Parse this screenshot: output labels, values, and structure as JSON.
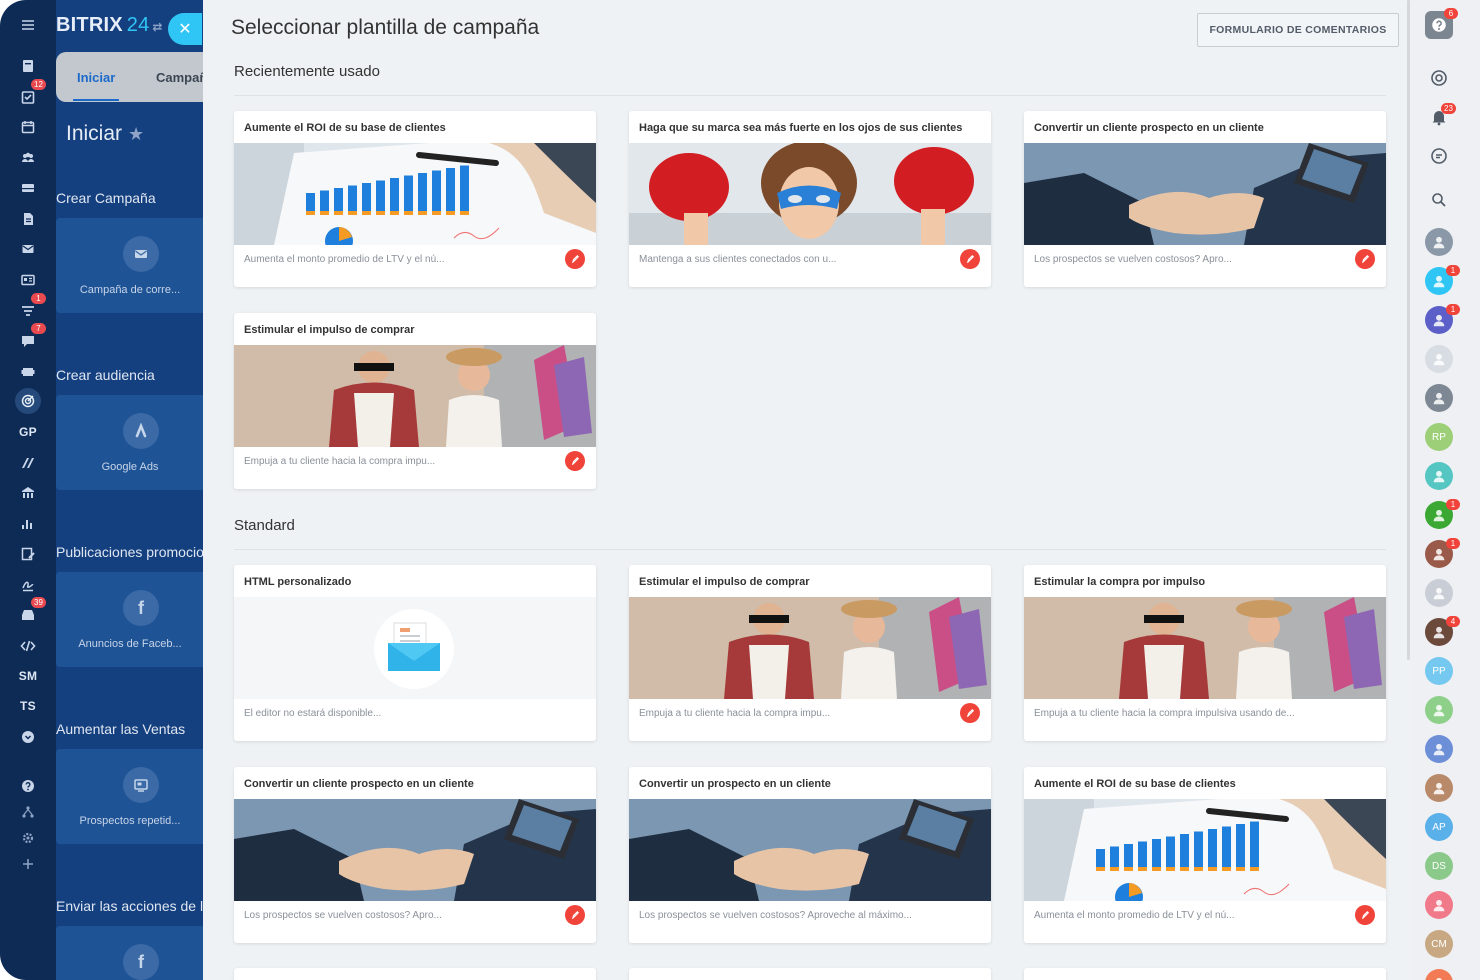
{
  "brand": {
    "name": "BITRIX",
    "version": "24"
  },
  "left_rail": {
    "items": [
      {
        "name": "menu-icon"
      },
      {
        "name": "feed-icon"
      },
      {
        "name": "tasks-icon",
        "badge": "12"
      },
      {
        "name": "calendar-icon"
      },
      {
        "name": "contacts-icon"
      },
      {
        "name": "drive-icon"
      },
      {
        "name": "documents-icon"
      },
      {
        "name": "mail-icon"
      },
      {
        "name": "crm-icon"
      },
      {
        "name": "funnel-icon",
        "badge": "1"
      },
      {
        "name": "chat-icon",
        "badge": "7"
      },
      {
        "name": "store-icon"
      },
      {
        "name": "marketing-icon"
      }
    ],
    "labels": {
      "gp": "GP",
      "sm": "SM",
      "ts": "TS"
    },
    "lower_badge": "39"
  },
  "left_panel": {
    "tabs": [
      "Iniciar",
      "Campañas"
    ],
    "title": "Iniciar",
    "sections": [
      {
        "title": "Crear Campaña",
        "tile": "Campaña de corre...",
        "icon": "mail-icon"
      },
      {
        "title": "Crear audiencia",
        "tile": "Google Ads",
        "icon": "google-ads-icon"
      },
      {
        "title": "Publicaciones promocionadas",
        "tile": "Anuncios de Faceb...",
        "icon": "facebook-icon"
      },
      {
        "title": "Aumentar las Ventas",
        "tile": "Prospectos repetid...",
        "icon": "leads-icon"
      },
      {
        "title": "Enviar las acciones de la empresa",
        "tile": "",
        "icon": "facebook-icon"
      }
    ]
  },
  "main": {
    "title": "Seleccionar plantilla de campaña",
    "feedback_button": "FORMULARIO DE COMENTARIOS",
    "recent_title": "Recientemente usado",
    "standard_title": "Standard",
    "recent_cards": [
      {
        "title": "Aumente el ROI de su base de clientes",
        "desc": "Aumenta el monto promedio de LTV y el nú...",
        "image": "chart",
        "badge": true
      },
      {
        "title": "Haga que su marca sea más fuerte en los ojos de sus clientes",
        "desc": "Mantenga a sus clientes conectados con u...",
        "image": "kid",
        "badge": true
      },
      {
        "title": "Convertir un cliente prospecto en un cliente",
        "desc": "Los prospectos se vuelven costosos? Apro...",
        "image": "handshake",
        "badge": true
      },
      {
        "title": "Estimular el impulso de comprar",
        "desc": "Empuja a tu cliente hacia la compra impu...",
        "image": "shopping",
        "badge": true
      }
    ],
    "standard_cards": [
      {
        "title": "HTML personalizado",
        "desc": "El editor no estará disponible...",
        "image": "html",
        "badge": false
      },
      {
        "title": "Estimular el impulso de comprar",
        "desc": "Empuja a tu cliente hacia la compra impu...",
        "image": "shopping",
        "badge": true
      },
      {
        "title": "Estimular la compra por impulso",
        "desc": "Empuja a tu cliente hacia la compra impulsiva usando de...",
        "image": "shopping",
        "badge": false
      },
      {
        "title": "Convertir un cliente prospecto en un cliente",
        "desc": "Los prospectos se vuelven costosos? Apro...",
        "image": "handshake",
        "badge": true
      },
      {
        "title": "Convertir un prospecto en un cliente",
        "desc": "Los prospectos se vuelven costosos? Aproveche al máximo...",
        "image": "handshake",
        "badge": false
      },
      {
        "title": "Aumente el ROI de su base de clientes",
        "desc": "Aumenta el monto promedio de LTV y el nú...",
        "image": "chart",
        "badge": true
      }
    ]
  },
  "right_rail": {
    "help_badge": "6",
    "notifications_badge": "23",
    "avatars": [
      {
        "initials": "",
        "color": "#8a98a8"
      },
      {
        "initials": "",
        "color": "#2fc6f6",
        "badge": "1"
      },
      {
        "initials": "",
        "color": "#5b5fc7",
        "badge": "1"
      },
      {
        "initials": "",
        "color": "#d7dde3"
      },
      {
        "initials": "",
        "color": "#7d8894"
      },
      {
        "initials": "RP",
        "color": "#9dcf78"
      },
      {
        "initials": "",
        "color": "#55c6c1"
      },
      {
        "initials": "",
        "color": "#3aa832",
        "badge": "1"
      },
      {
        "initials": "",
        "color": "#9a5a4a",
        "badge": "1"
      },
      {
        "initials": "",
        "color": "#c9ced6"
      },
      {
        "initials": "",
        "color": "#6b4a3c",
        "badge": "4"
      },
      {
        "initials": "PP",
        "color": "#75c8ef"
      },
      {
        "initials": "",
        "color": "#8ed08a"
      },
      {
        "initials": "",
        "color": "#6d8fd8"
      },
      {
        "initials": "",
        "color": "#b98a6a"
      },
      {
        "initials": "AP",
        "color": "#5ab0e8"
      },
      {
        "initials": "DS",
        "color": "#8bc98b"
      },
      {
        "initials": "",
        "color": "#f07a8a"
      },
      {
        "initials": "CM",
        "color": "#c8a882"
      },
      {
        "initials": "",
        "color": "#f27b55"
      }
    ]
  }
}
